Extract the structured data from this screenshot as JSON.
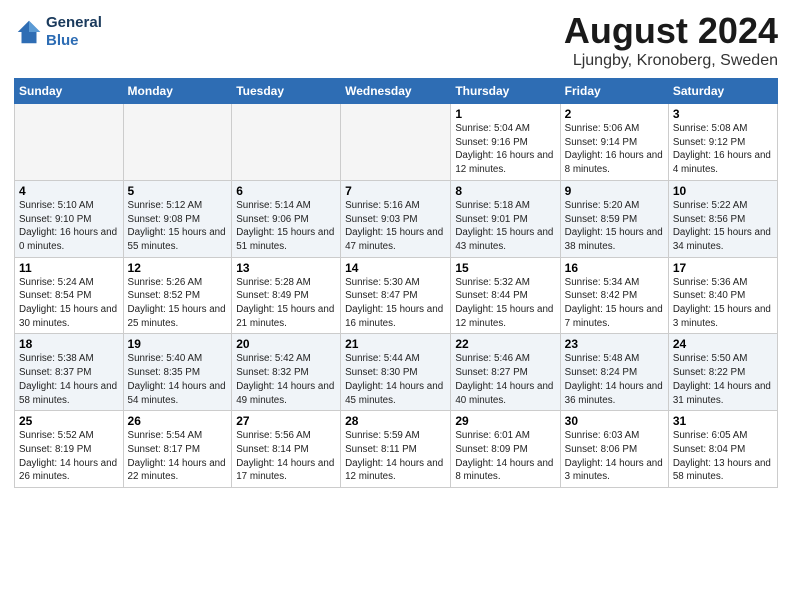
{
  "logo": {
    "line1": "General",
    "line2": "Blue"
  },
  "title": "August 2024",
  "location": "Ljungby, Kronoberg, Sweden",
  "days_of_week": [
    "Sunday",
    "Monday",
    "Tuesday",
    "Wednesday",
    "Thursday",
    "Friday",
    "Saturday"
  ],
  "weeks": [
    [
      {
        "day": "",
        "info": ""
      },
      {
        "day": "",
        "info": ""
      },
      {
        "day": "",
        "info": ""
      },
      {
        "day": "",
        "info": ""
      },
      {
        "day": "1",
        "info": "Sunrise: 5:04 AM\nSunset: 9:16 PM\nDaylight: 16 hours\nand 12 minutes."
      },
      {
        "day": "2",
        "info": "Sunrise: 5:06 AM\nSunset: 9:14 PM\nDaylight: 16 hours\nand 8 minutes."
      },
      {
        "day": "3",
        "info": "Sunrise: 5:08 AM\nSunset: 9:12 PM\nDaylight: 16 hours\nand 4 minutes."
      }
    ],
    [
      {
        "day": "4",
        "info": "Sunrise: 5:10 AM\nSunset: 9:10 PM\nDaylight: 16 hours\nand 0 minutes."
      },
      {
        "day": "5",
        "info": "Sunrise: 5:12 AM\nSunset: 9:08 PM\nDaylight: 15 hours\nand 55 minutes."
      },
      {
        "day": "6",
        "info": "Sunrise: 5:14 AM\nSunset: 9:06 PM\nDaylight: 15 hours\nand 51 minutes."
      },
      {
        "day": "7",
        "info": "Sunrise: 5:16 AM\nSunset: 9:03 PM\nDaylight: 15 hours\nand 47 minutes."
      },
      {
        "day": "8",
        "info": "Sunrise: 5:18 AM\nSunset: 9:01 PM\nDaylight: 15 hours\nand 43 minutes."
      },
      {
        "day": "9",
        "info": "Sunrise: 5:20 AM\nSunset: 8:59 PM\nDaylight: 15 hours\nand 38 minutes."
      },
      {
        "day": "10",
        "info": "Sunrise: 5:22 AM\nSunset: 8:56 PM\nDaylight: 15 hours\nand 34 minutes."
      }
    ],
    [
      {
        "day": "11",
        "info": "Sunrise: 5:24 AM\nSunset: 8:54 PM\nDaylight: 15 hours\nand 30 minutes."
      },
      {
        "day": "12",
        "info": "Sunrise: 5:26 AM\nSunset: 8:52 PM\nDaylight: 15 hours\nand 25 minutes."
      },
      {
        "day": "13",
        "info": "Sunrise: 5:28 AM\nSunset: 8:49 PM\nDaylight: 15 hours\nand 21 minutes."
      },
      {
        "day": "14",
        "info": "Sunrise: 5:30 AM\nSunset: 8:47 PM\nDaylight: 15 hours\nand 16 minutes."
      },
      {
        "day": "15",
        "info": "Sunrise: 5:32 AM\nSunset: 8:44 PM\nDaylight: 15 hours\nand 12 minutes."
      },
      {
        "day": "16",
        "info": "Sunrise: 5:34 AM\nSunset: 8:42 PM\nDaylight: 15 hours\nand 7 minutes."
      },
      {
        "day": "17",
        "info": "Sunrise: 5:36 AM\nSunset: 8:40 PM\nDaylight: 15 hours\nand 3 minutes."
      }
    ],
    [
      {
        "day": "18",
        "info": "Sunrise: 5:38 AM\nSunset: 8:37 PM\nDaylight: 14 hours\nand 58 minutes."
      },
      {
        "day": "19",
        "info": "Sunrise: 5:40 AM\nSunset: 8:35 PM\nDaylight: 14 hours\nand 54 minutes."
      },
      {
        "day": "20",
        "info": "Sunrise: 5:42 AM\nSunset: 8:32 PM\nDaylight: 14 hours\nand 49 minutes."
      },
      {
        "day": "21",
        "info": "Sunrise: 5:44 AM\nSunset: 8:30 PM\nDaylight: 14 hours\nand 45 minutes."
      },
      {
        "day": "22",
        "info": "Sunrise: 5:46 AM\nSunset: 8:27 PM\nDaylight: 14 hours\nand 40 minutes."
      },
      {
        "day": "23",
        "info": "Sunrise: 5:48 AM\nSunset: 8:24 PM\nDaylight: 14 hours\nand 36 minutes."
      },
      {
        "day": "24",
        "info": "Sunrise: 5:50 AM\nSunset: 8:22 PM\nDaylight: 14 hours\nand 31 minutes."
      }
    ],
    [
      {
        "day": "25",
        "info": "Sunrise: 5:52 AM\nSunset: 8:19 PM\nDaylight: 14 hours\nand 26 minutes."
      },
      {
        "day": "26",
        "info": "Sunrise: 5:54 AM\nSunset: 8:17 PM\nDaylight: 14 hours\nand 22 minutes."
      },
      {
        "day": "27",
        "info": "Sunrise: 5:56 AM\nSunset: 8:14 PM\nDaylight: 14 hours\nand 17 minutes."
      },
      {
        "day": "28",
        "info": "Sunrise: 5:59 AM\nSunset: 8:11 PM\nDaylight: 14 hours\nand 12 minutes."
      },
      {
        "day": "29",
        "info": "Sunrise: 6:01 AM\nSunset: 8:09 PM\nDaylight: 14 hours\nand 8 minutes."
      },
      {
        "day": "30",
        "info": "Sunrise: 6:03 AM\nSunset: 8:06 PM\nDaylight: 14 hours\nand 3 minutes."
      },
      {
        "day": "31",
        "info": "Sunrise: 6:05 AM\nSunset: 8:04 PM\nDaylight: 13 hours\nand 58 minutes."
      }
    ]
  ]
}
